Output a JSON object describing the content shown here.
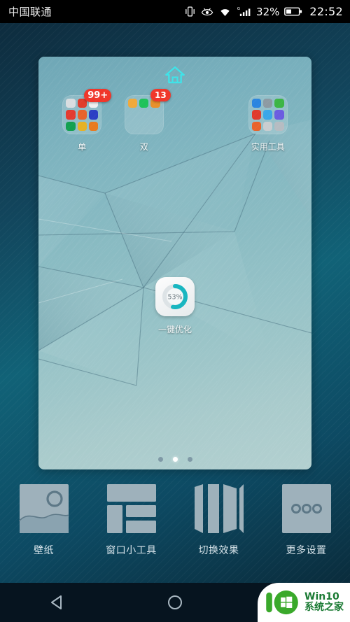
{
  "status_bar": {
    "carrier": "中国联通",
    "battery_percent": "32%",
    "clock": "22:52",
    "icons": [
      "vibrate-icon",
      "eye-care-icon",
      "wifi-icon",
      "signal-g-icon",
      "battery-icon"
    ]
  },
  "home_preview": {
    "home_indicator_icon": "home-icon",
    "folders": [
      {
        "label": "单",
        "badge": "99+",
        "icon_colors": [
          "#d9dde0",
          "#e03c2c",
          "#f0f0f0",
          "#e33b2f",
          "#e8632b",
          "#2a3fc4",
          "#12a050",
          "#e7b224",
          "#e87a1e"
        ]
      },
      {
        "label": "双",
        "badge": "13",
        "icon_colors": [
          "#f0a93c",
          "#1fc25a",
          "#e8902c",
          "",
          "",
          "",
          "",
          "",
          ""
        ]
      },
      {
        "label": "",
        "badge": "",
        "icon_colors": [
          "",
          "",
          "",
          "",
          "",
          "",
          "",
          "",
          ""
        ]
      },
      {
        "label": "实用工具",
        "badge": "",
        "icon_colors": [
          "#2a85e0",
          "#8d9aa3",
          "#3cb544",
          "#e03a2c",
          "#3aa7e8",
          "#6b5ce0",
          "#e8632b",
          "#c9cdd0",
          "#b6bcc2"
        ]
      }
    ],
    "optimizer": {
      "label": "一键优化",
      "percent": "53%",
      "percent_value": 53,
      "ring_color": "#18b6c0",
      "track_color": "#dde3e6"
    }
  },
  "page_dots": {
    "count": 3,
    "active_index": 1
  },
  "option_menu": [
    {
      "label": "壁纸",
      "icon": "wallpaper-icon"
    },
    {
      "label": "窗口小工具",
      "icon": "widgets-icon"
    },
    {
      "label": "切换效果",
      "icon": "transition-effect-icon"
    },
    {
      "label": "更多设置",
      "icon": "more-settings-icon"
    }
  ],
  "nav_bar": [
    {
      "name": "back-button",
      "icon": "triangle-left-icon"
    },
    {
      "name": "home-button",
      "icon": "circle-icon"
    },
    {
      "name": "recents-button",
      "icon": "square-icon"
    }
  ],
  "watermark": {
    "line1": "Win10",
    "line2": "系统之家",
    "logo": "win10-logo-icon"
  },
  "colors": {
    "accent_cyan": "#18b6c0",
    "badge_red": "#f0362a",
    "backdrop_dark": "#0b2230",
    "nav_dark": "#06141f",
    "watermark_green": "#1a7a33"
  }
}
